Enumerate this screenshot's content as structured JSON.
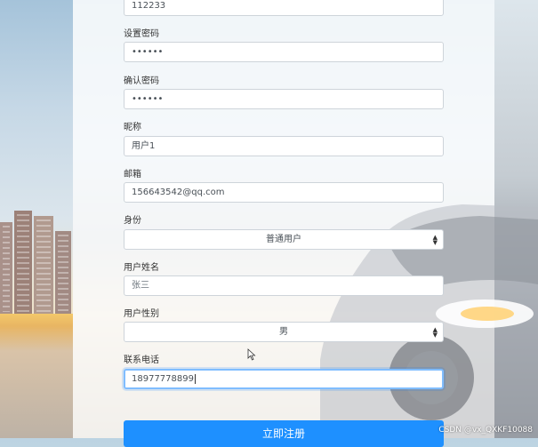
{
  "form": {
    "fields": [
      {
        "label": "",
        "value": "112233"
      },
      {
        "label": "设置密码",
        "value": "••••••"
      },
      {
        "label": "确认密码",
        "value": "••••••"
      },
      {
        "label": "昵称",
        "value": "用户1"
      },
      {
        "label": "邮箱",
        "value": "156643542@qq.com"
      }
    ],
    "identity": {
      "label": "身份",
      "selected": "普通用户"
    },
    "real_name": {
      "label": "用户姓名",
      "placeholder": "张三"
    },
    "gender": {
      "label": "用户性别",
      "selected": "男"
    },
    "phone": {
      "label": "联系电话",
      "value": "18977778899"
    },
    "submit_label": "立即注册"
  },
  "watermark": "CSDN @vx_QXKF10088",
  "colors": {
    "primary": "#1e90ff",
    "focus_border": "#80bdff"
  }
}
